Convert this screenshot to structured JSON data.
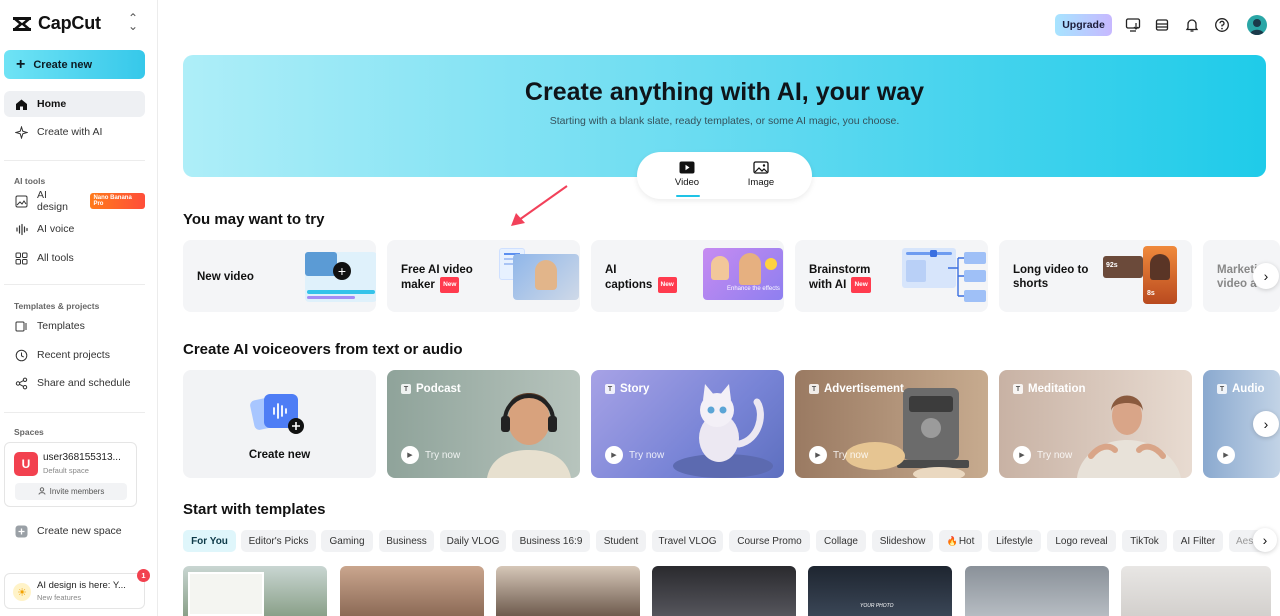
{
  "app": {
    "name": "CapCut"
  },
  "sidebar": {
    "create_new": "Create new",
    "nav": [
      {
        "label": "Home",
        "icon": "home-icon"
      },
      {
        "label": "Create with AI",
        "icon": "sparkle-icon"
      }
    ],
    "ai_tools_label": "AI tools",
    "ai_tools": [
      {
        "label": "AI design",
        "badge": "Nano Banana Pro",
        "icon": "image-edit-icon"
      },
      {
        "label": "AI voice",
        "icon": "waveform-icon"
      },
      {
        "label": "All tools",
        "icon": "grid-icon"
      }
    ],
    "templates_label": "Templates & projects",
    "templates_items": [
      {
        "label": "Templates",
        "icon": "template-icon"
      },
      {
        "label": "Recent projects",
        "icon": "clock-icon"
      },
      {
        "label": "Share and schedule",
        "icon": "share-icon"
      }
    ],
    "spaces_label": "Spaces",
    "space": {
      "avatar_letter": "U",
      "name": "user368155313...",
      "subtitle": "Default space",
      "invite": "Invite members"
    },
    "create_space": "Create new space",
    "notification": {
      "title": "AI design is here: Y...",
      "subtitle": "New features",
      "count": "1"
    }
  },
  "topbar": {
    "upgrade": "Upgrade"
  },
  "hero": {
    "title": "Create anything with AI, your way",
    "subtitle": "Starting with a blank slate, ready templates, or some AI magic, you choose.",
    "tabs": [
      "Video",
      "Image"
    ],
    "active_tab": "Video"
  },
  "try_section": {
    "title": "You may want to try",
    "new_badge": "New",
    "cards": [
      {
        "line1": "New video",
        "line2": "",
        "is_new": false
      },
      {
        "line1": "Free AI video",
        "line2": "maker",
        "is_new": true
      },
      {
        "line1": "AI",
        "line2": "captions",
        "is_new": true
      },
      {
        "line1": "Brainstorm",
        "line2": "with AI",
        "is_new": true
      },
      {
        "line1": "Long video to",
        "line2": "shorts",
        "is_new": false
      },
      {
        "line1": "Marketing",
        "line2": "video a",
        "is_new": false
      }
    ],
    "captions_overlay": "Enhance the effects",
    "shorts_duration_1": "92s",
    "shorts_duration_2": "8s"
  },
  "voice_section": {
    "title": "Create AI voiceovers from text or audio",
    "create_new": "Create new",
    "try_now": "Try now",
    "cards": [
      "Podcast",
      "Story",
      "Advertisement",
      "Meditation",
      "Audio"
    ]
  },
  "templates_section": {
    "title": "Start with templates",
    "chips": [
      "For You",
      "Editor's Picks",
      "Gaming",
      "Business",
      "Daily VLOG",
      "Business 16:9",
      "Student",
      "Travel VLOG",
      "Course Promo",
      "Collage",
      "Slideshow",
      "Hot",
      "Lifestyle",
      "Logo reveal",
      "TikTok",
      "AI Filter",
      "Aes"
    ],
    "active_chip": "For You",
    "thumb_text": "YOUR PHOTO"
  },
  "colors": {
    "accent": "#1fcbe9",
    "new_badge": "#ff3b4e",
    "nano_badge": "#ff6a2a"
  }
}
